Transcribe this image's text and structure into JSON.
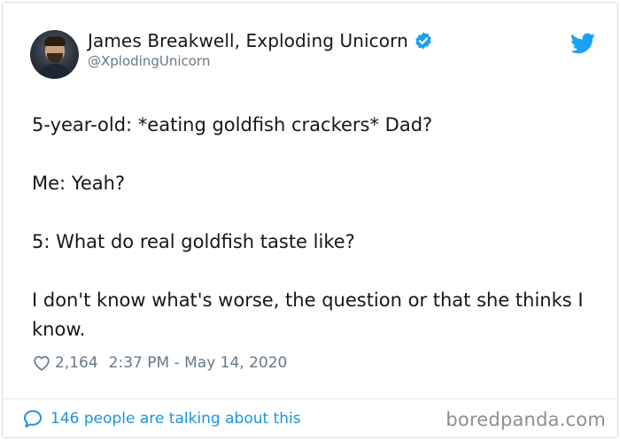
{
  "author": {
    "display_name": "James Breakwell, Exploding Unicorn",
    "handle": "@XplodingUnicorn",
    "verified": true
  },
  "tweet": {
    "lines": [
      "5-year-old: *eating goldfish crackers* Dad?",
      "Me: Yeah?",
      "5: What do real goldfish taste like?",
      "I don't know what's worse, the question or that she thinks I know."
    ]
  },
  "meta": {
    "likes": "2,164",
    "timestamp": "2:37 PM - May 14, 2020"
  },
  "footer": {
    "conversation": "146 people are talking about this",
    "watermark": "boredpanda.com"
  },
  "colors": {
    "twitter_blue": "#1da1f2",
    "link_blue": "#1b95e0",
    "secondary_text": "#657786"
  },
  "icons": [
    "verified-badge-icon",
    "twitter-bird-icon",
    "heart-icon",
    "speech-bubble-icon"
  ]
}
